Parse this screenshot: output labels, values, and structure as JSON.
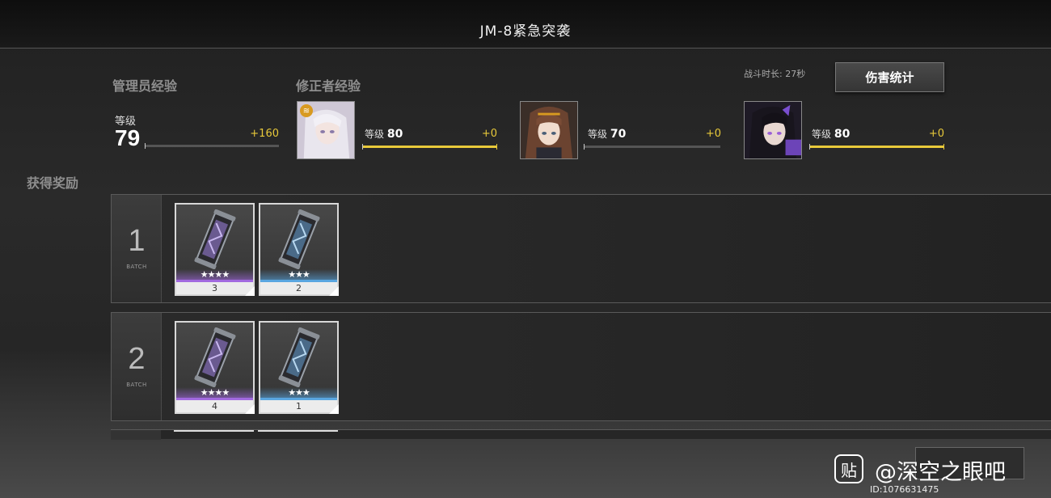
{
  "title": "JM-8紧急突袭",
  "labels": {
    "admin_exp": "管理员经验",
    "corrector_exp": "修正者经验",
    "rewards": "获得奖励",
    "battle_time": "战斗时长: 27秒",
    "damage_stats": "伤害统计",
    "level_word": "等级",
    "batch_word": "BATCH"
  },
  "admin": {
    "level": "79",
    "gain": "+160",
    "progress": 0.0
  },
  "characters": [
    {
      "level_label": "等级",
      "level": "80",
      "gain": "+0",
      "progress": 1.0,
      "badge": "≋"
    },
    {
      "level_label": "等级",
      "level": "70",
      "gain": "+0",
      "progress": 0.0
    },
    {
      "level_label": "等级",
      "level": "80",
      "gain": "+0",
      "progress": 1.0
    }
  ],
  "batches": [
    {
      "number": "1",
      "items": [
        {
          "stars": "★★★★",
          "count": "3",
          "rarity_color": "#a26adf"
        },
        {
          "stars": "★★★",
          "count": "2",
          "rarity_color": "#5aa6e0"
        }
      ]
    },
    {
      "number": "2",
      "items": [
        {
          "stars": "★★★★",
          "count": "4",
          "rarity_color": "#a26adf"
        },
        {
          "stars": "★★★",
          "count": "1",
          "rarity_color": "#5aa6e0"
        }
      ]
    }
  ],
  "watermark": {
    "icon": "贴",
    "text": "@深空之眼吧",
    "id": "ID:1076631475"
  },
  "colors": {
    "accent_yellow": "#e8c93a",
    "purple_rarity": "#a26adf",
    "blue_rarity": "#5aa6e0"
  }
}
